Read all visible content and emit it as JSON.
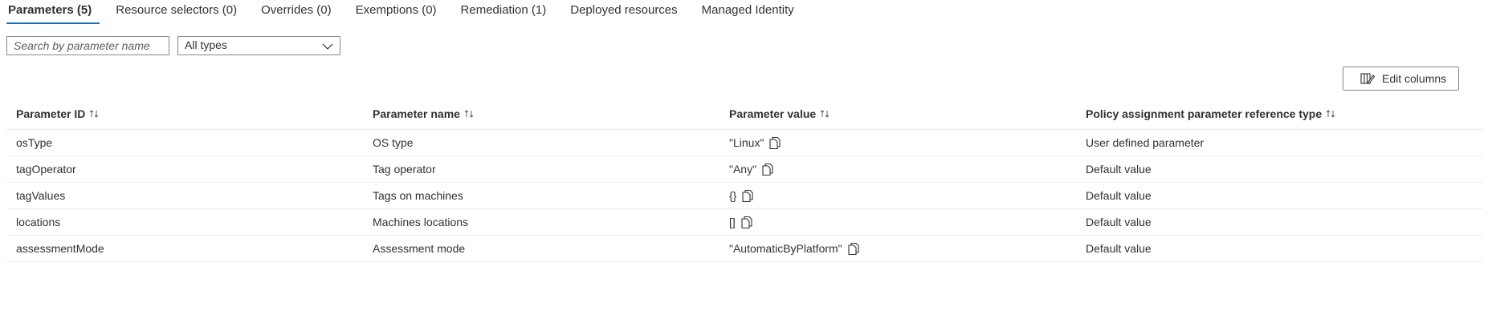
{
  "tabs": [
    {
      "label": "Parameters (5)",
      "selected": true
    },
    {
      "label": "Resource selectors (0)",
      "selected": false
    },
    {
      "label": "Overrides (0)",
      "selected": false
    },
    {
      "label": "Exemptions (0)",
      "selected": false
    },
    {
      "label": "Remediation (1)",
      "selected": false
    },
    {
      "label": "Deployed resources",
      "selected": false
    },
    {
      "label": "Managed Identity",
      "selected": false
    }
  ],
  "filters": {
    "search_placeholder": "Search by parameter name",
    "search_value": "",
    "type_selected": "All types"
  },
  "toolbar": {
    "edit_columns_label": "Edit columns"
  },
  "table": {
    "columns": [
      "Parameter ID",
      "Parameter name",
      "Parameter value",
      "Policy assignment parameter reference type"
    ],
    "rows": [
      {
        "id": "osType",
        "name": "OS type",
        "value": "\"Linux\"",
        "ref_type": "User defined parameter"
      },
      {
        "id": "tagOperator",
        "name": "Tag operator",
        "value": "\"Any\"",
        "ref_type": "Default value"
      },
      {
        "id": "tagValues",
        "name": "Tags on machines",
        "value": "{}",
        "ref_type": "Default value"
      },
      {
        "id": "locations",
        "name": "Machines locations",
        "value": "[]",
        "ref_type": "Default value"
      },
      {
        "id": "assessmentMode",
        "name": "Assessment mode",
        "value": "\"AutomaticByPlatform\"",
        "ref_type": "Default value"
      }
    ]
  },
  "colors": {
    "accent": "#0078d4",
    "border": "#8a8886",
    "divider": "#edebe9",
    "text": "#323130"
  },
  "icons": {
    "sort": "sort-arrows-icon",
    "copy": "copy-icon",
    "dropdown": "chevron-down-icon",
    "edit_columns": "edit-columns-icon"
  }
}
